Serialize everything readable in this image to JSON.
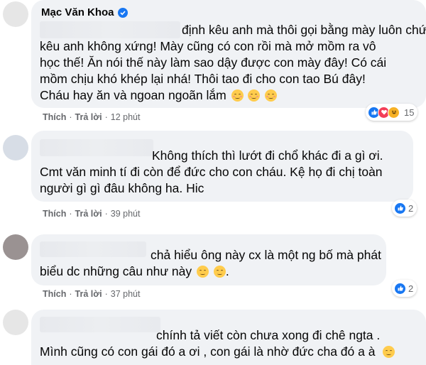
{
  "comments": [
    {
      "author": "Mạc Văn Khoa",
      "lines": [
        "định kêu anh mà thôi gọi bằng mày luôn chứ",
        "kêu anh không xứng! Mày cũng có con rồi mà mở mồm ra vô",
        "học thế! Ăn nói thế này làm sao dậy được con mày đây! Có cái",
        "mồm chịu khó khép lại nhá! Thôi tao đi cho con tao Bú đây!",
        "Cháu hay ăn và ngoan ngoãn lắm"
      ],
      "like_label": "Thích",
      "reply_label": "Trả lời",
      "time": "12 phút",
      "reaction_count": "15",
      "reactions": [
        "like-icon",
        "love-icon",
        "haha-icon"
      ]
    },
    {
      "lines": [
        "Không thích thì lướt đi chổ khác đi a gì ơi.",
        "Cmt văn minh tí đi còn để đức cho con cháu. Kệ họ đi chị toàn",
        "người gì gì đâu không ha. Hic"
      ],
      "like_label": "Thích",
      "reply_label": "Trả lời",
      "time": "39 phút",
      "reaction_count": "2",
      "reactions": [
        "like-icon"
      ]
    },
    {
      "lines": [
        "chả hiểu ông này cx là một ng bố mà phát",
        "biểu dc những câu như này"
      ],
      "like_label": "Thích",
      "reply_label": "Trả lời",
      "time": "37 phút",
      "reaction_count": "2",
      "reactions": [
        "like-icon"
      ]
    },
    {
      "lines": [
        "chính tả viết còn chưa xong đi chê ngta .",
        "Mình cũng có con gái đó a ơi , con gái là nhờ đức cha đó a à"
      ]
    }
  ],
  "colors": {
    "bubble": "#f0f2f5",
    "meta": "#65676b",
    "like": "#1877f2",
    "love": "#f33e58",
    "haha": "#f7b125"
  }
}
